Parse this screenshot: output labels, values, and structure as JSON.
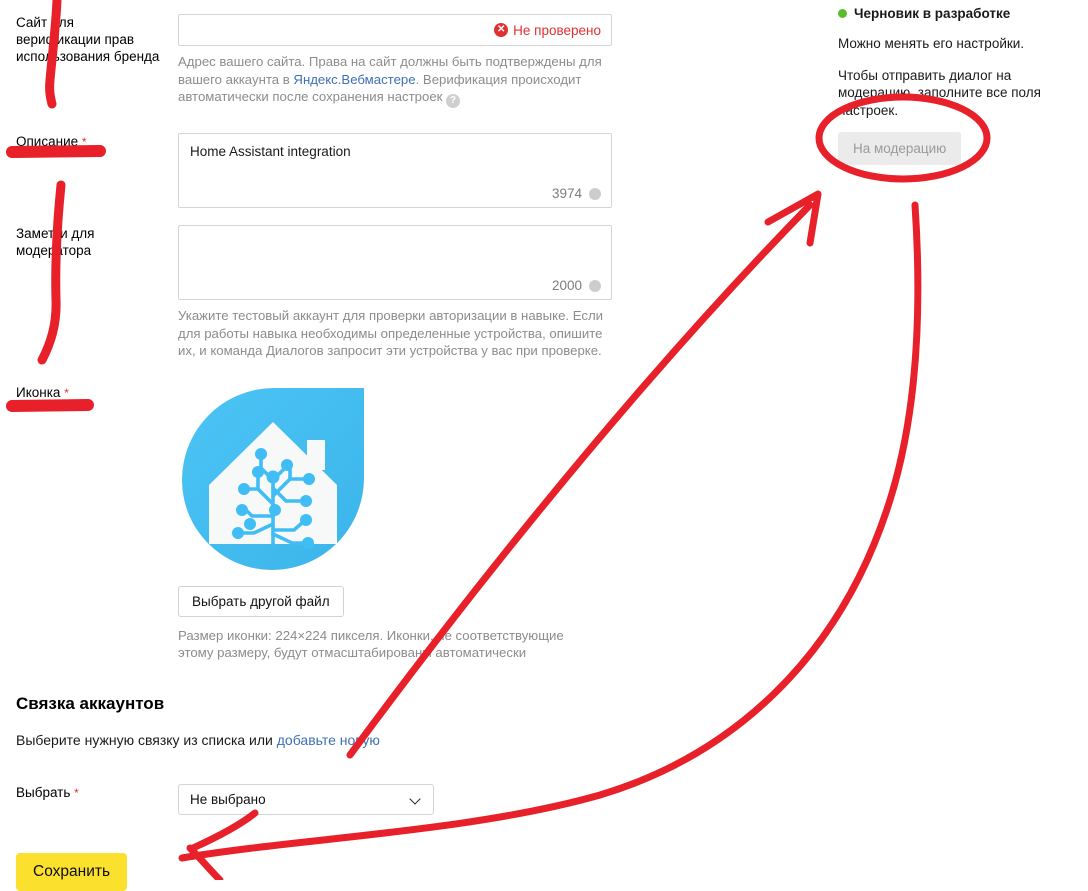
{
  "form": {
    "site_field": {
      "label": "Сайт для верификации прав использования бренда",
      "value": "",
      "status_text": "Не проверено",
      "status_icon": "error-circle-icon",
      "status_color": "#e03131",
      "hint_part1": "Адрес вашего сайта. Права на сайт должны быть подтверждены для вашего аккаунта в ",
      "hint_link": "Яндекс.Вебмастере",
      "hint_part2": ". Верификация происходит автоматически после сохранения настроек ",
      "help_icon": "question-mark-icon"
    },
    "description_field": {
      "label": "Описание",
      "required_mark": "*",
      "value": "Home Assistant integration",
      "counter": "3974"
    },
    "moderator_notes_field": {
      "label": "Заметки для модератора",
      "value": "",
      "counter": "2000",
      "hint": "Укажите тестовый аккаунт для проверки авторизации в навыке. Если для работы навыка необходимы определенные устройства, опишите их, и команда Диалогов запросит эти устройства у вас при проверке."
    },
    "icon_field": {
      "label": "Иконка",
      "required_mark": "*",
      "image_alt": "home-assistant-logo",
      "image_bg_color": "#41bdf5",
      "choose_file_button": "Выбрать другой файл",
      "hint": "Размер иконки: 224×224 пикселя. Иконки, не соответствующие этому размеру, будут отмасштабированы автоматически"
    }
  },
  "account_linking": {
    "title": "Связка аккаунтов",
    "subtitle_part1": "Выберите нужную связку из списка или ",
    "subtitle_link": "добавьте новую",
    "select_label": "Выбрать",
    "select_required_mark": "*",
    "select_value": "Не выбрано",
    "chevron_icon": "chevron-down-icon"
  },
  "save_button": {
    "label": "Сохранить",
    "color": "#fce02e"
  },
  "sidebar": {
    "status_icon": "green-dot-icon",
    "status_text": "Черновик в разработке",
    "status_color": "#5bbd2a",
    "paragraph1": "Можно менять его настройки.",
    "paragraph2": "Чтобы отправить диалог на модерацию, заполните все поля настроек.",
    "moderation_button": "На модерацию"
  },
  "annotations": {
    "color": "#e8202a",
    "marks": [
      "vertical-stroke-near-site-label",
      "underline-under-description-label",
      "vertical-stroke-near-notes-label",
      "underline-under-icon-label",
      "arrow-to-moderation-button",
      "curve-from-save-to-moderation",
      "arrow-to-save-button",
      "ellipse-around-moderation-button"
    ]
  }
}
